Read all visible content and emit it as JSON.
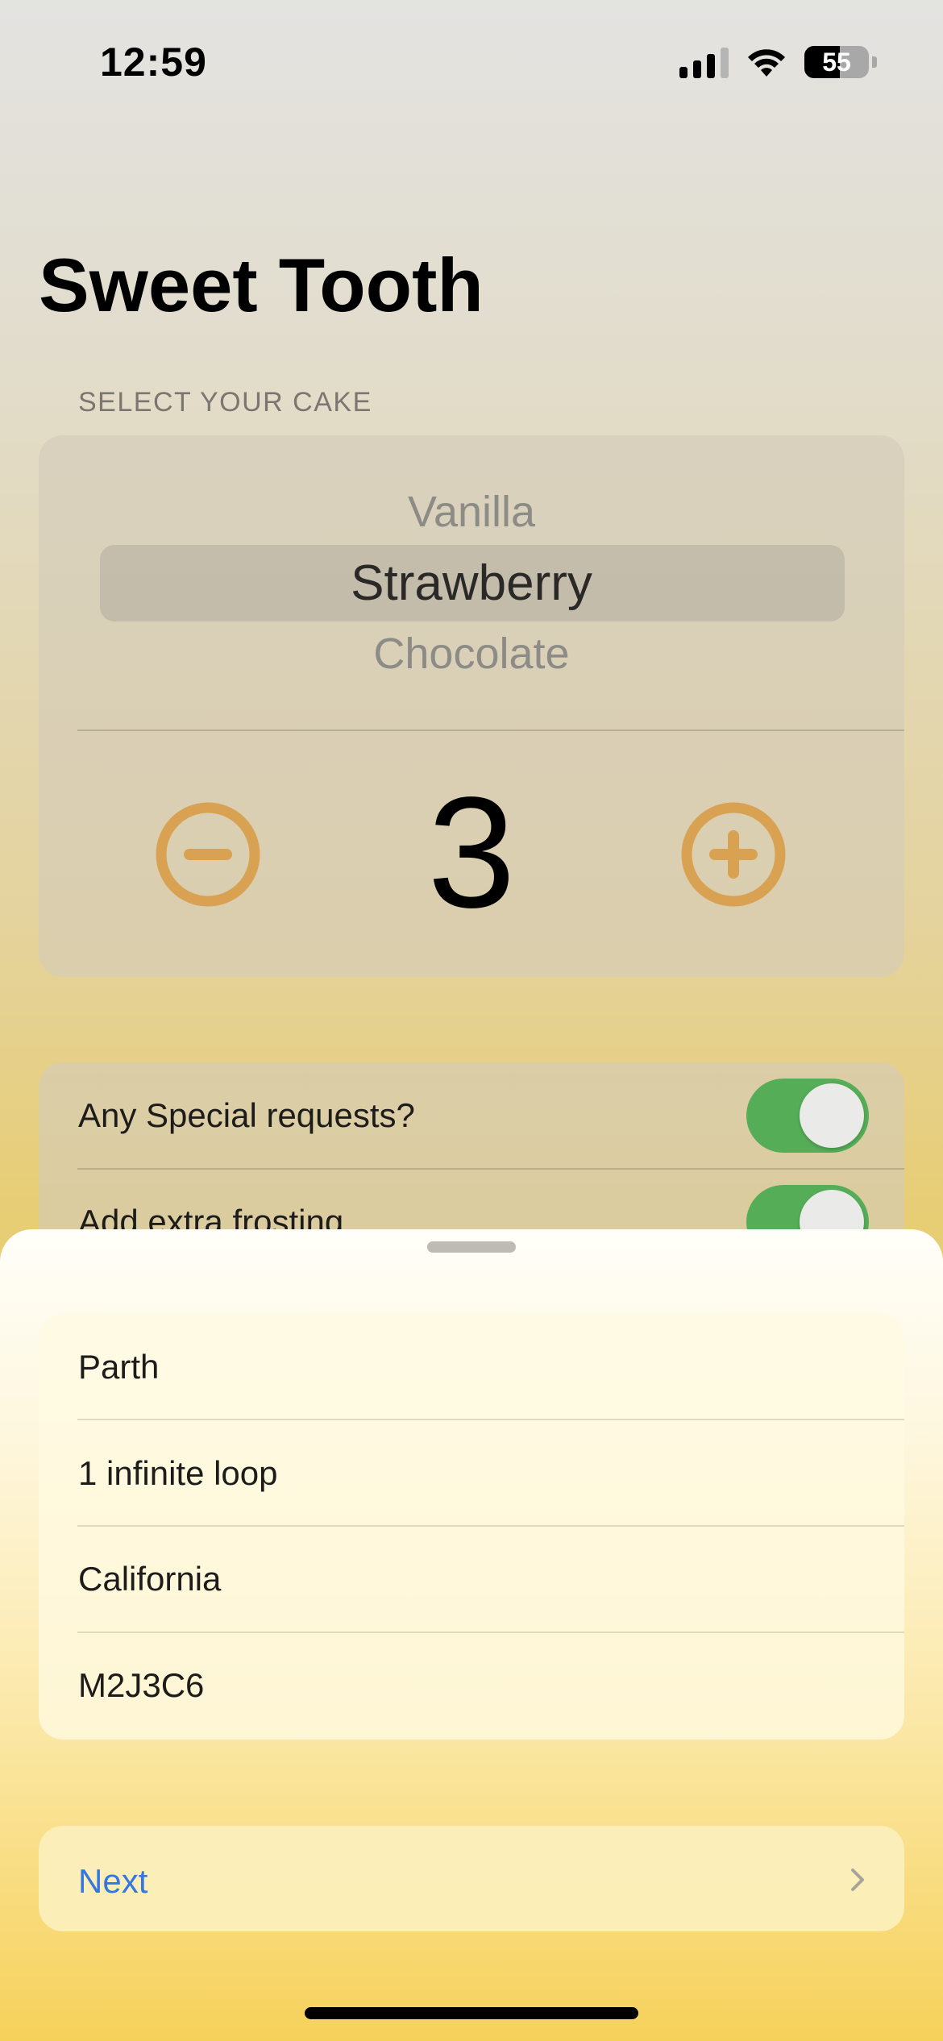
{
  "status_bar": {
    "time": "12:59",
    "battery": "55"
  },
  "app": {
    "title": "Sweet Tooth"
  },
  "cake": {
    "section_label": "SELECT YOUR CAKE",
    "picker": {
      "previous": "Vanilla",
      "selected": "Strawberry",
      "next": "Chocolate"
    },
    "quantity": "3"
  },
  "options": [
    {
      "label": "Any Special requests?",
      "on": true
    },
    {
      "label": "Add extra frosting",
      "on": true
    }
  ],
  "address_form": {
    "fields": [
      {
        "value": "Parth"
      },
      {
        "value": "1 infinite loop"
      },
      {
        "value": "California"
      },
      {
        "value": "M2J3C6"
      }
    ]
  },
  "next_button": {
    "label": "Next"
  },
  "colors": {
    "accent_orange": "#d9a152",
    "toggle_green": "#55ad58",
    "link_blue": "#3377e0"
  }
}
